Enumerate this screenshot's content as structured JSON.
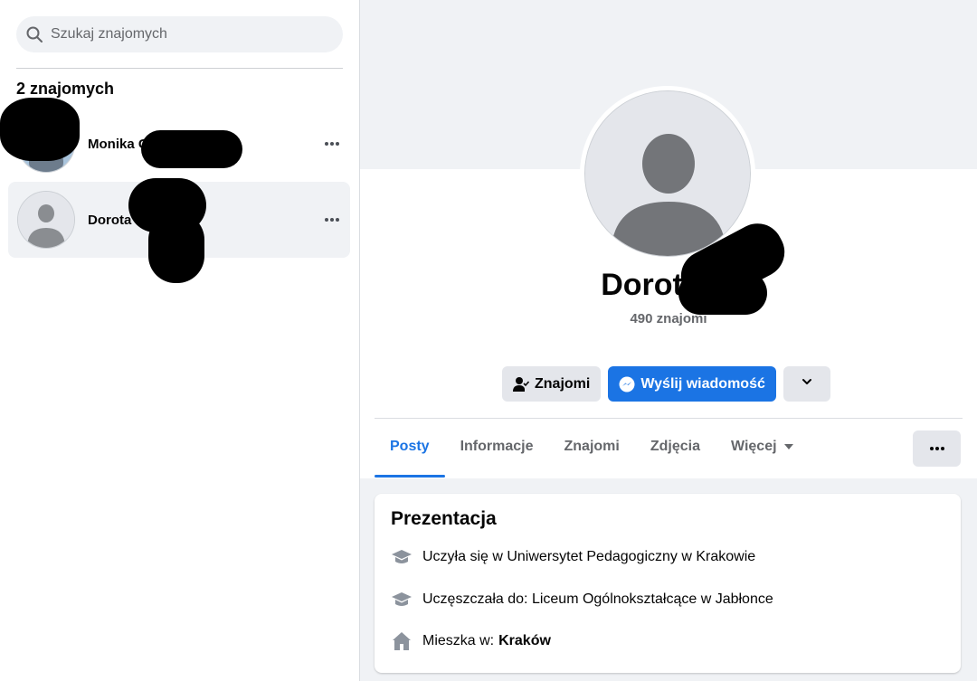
{
  "sidebar": {
    "search": {
      "placeholder": "Szukaj znajomych",
      "value": ""
    },
    "friends_count": "2 znajomych",
    "friends": [
      {
        "name": "Monika C",
        "more_icon": "more-horizontal-icon"
      },
      {
        "name": "Dorota W",
        "more_icon": "more-horizontal-icon"
      }
    ]
  },
  "profile": {
    "name": "Dorota",
    "friends_label": "490 znajomi",
    "actions": {
      "friends_button": "Znajomi",
      "message_button": "Wyślij wiadomość"
    },
    "tabs": [
      "Posty",
      "Informacje",
      "Znajomi",
      "Zdjęcia",
      "Więcej"
    ],
    "active_tab": "Posty",
    "intro": {
      "title": "Prezentacja",
      "items": [
        {
          "icon": "graduation-cap-icon",
          "text": "Uczyła się w Uniwersytet Pedagogiczny w Krakowie"
        },
        {
          "icon": "graduation-cap-icon",
          "text": "Uczęszczała do: Liceum Ogólnokształcące w Jabłonce"
        },
        {
          "icon": "home-icon",
          "prefix": "Mieszka w:",
          "bold": "Kraków"
        }
      ]
    }
  },
  "colors": {
    "accent": "#1b74e4",
    "background": "#f0f2f5",
    "secondary_text": "#65676b"
  }
}
